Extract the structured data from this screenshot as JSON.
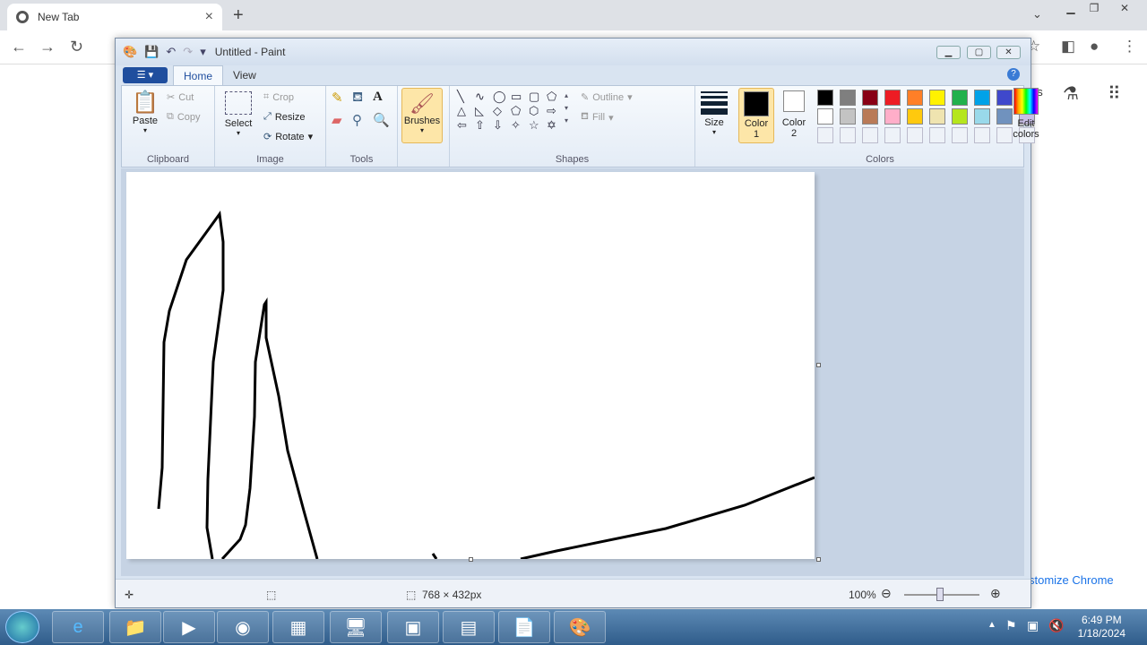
{
  "browser": {
    "tab_title": "New Tab",
    "new_tab_symbol": "+",
    "shortcut_partial": "es",
    "customize_partial": "stomize Chrome"
  },
  "paint": {
    "title": "Untitled - Paint",
    "tabs": {
      "home": "Home",
      "view": "View"
    },
    "clipboard": {
      "paste": "Paste",
      "cut": "Cut",
      "copy": "Copy",
      "group": "Clipboard"
    },
    "image": {
      "select": "Select",
      "crop": "Crop",
      "resize": "Resize",
      "rotate": "Rotate",
      "group": "Image"
    },
    "tools": {
      "group": "Tools"
    },
    "brushes": "Brushes",
    "shapes": {
      "outline": "Outline",
      "fill": "Fill",
      "group": "Shapes"
    },
    "size": "Size",
    "color1": "Color\n1",
    "color2": "Color\n2",
    "edit_colors": "Edit\ncolors",
    "colors_group": "Colors",
    "palette_row1": [
      "#000000",
      "#7f7f7f",
      "#880015",
      "#ed1c24",
      "#ff7f27",
      "#fff200",
      "#22b14c",
      "#00a2e8",
      "#3f48cc",
      "#a349a4"
    ],
    "palette_row2": [
      "#ffffff",
      "#c3c3c3",
      "#b97a57",
      "#ffaec9",
      "#ffc90e",
      "#efe4b0",
      "#b5e61d",
      "#99d9ea",
      "#7092be",
      "#c8bfe7"
    ],
    "status": {
      "dimensions": "768 × 432px",
      "zoom": "100%"
    }
  },
  "taskbar": {
    "time": "6:49 PM",
    "date": "1/18/2024"
  }
}
